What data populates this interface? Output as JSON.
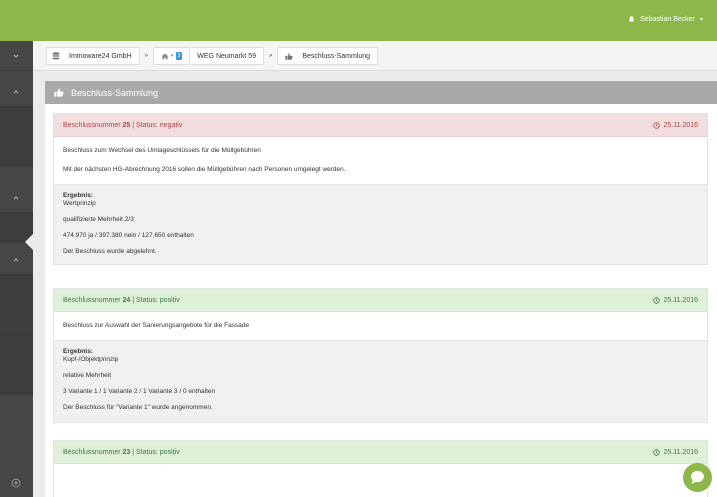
{
  "user": {
    "name": "Sebastian Becker",
    "caret": "▾"
  },
  "breadcrumb": {
    "company": "Immoware24 GmbH",
    "sep": "»",
    "home_caret": "▾",
    "badge": "3",
    "property": "WEG Neumarkt 59",
    "page": "Beschluss-Sammlung"
  },
  "panel": {
    "title": "Beschluss-Sammlung"
  },
  "resolutions": [
    {
      "prefix": "Beschlussnummer",
      "number": "25",
      "status_text": "| Status: negativ",
      "date": "25.11.2016",
      "title": "Beschluss zum Wechsel des Umlageschlüssels für die Müllgebühren",
      "description": "Mit der nächsten HG-Abrechnung 2016 sollen die Müllgebühren nach Personen umgelegt werden.",
      "result_label": "Ergebnis:",
      "principle": "Wertprinzip",
      "majority": "qualifizierte Mehrheit 2/3",
      "votes": "474.970 ja / 397.380 nein / 127.650 enthalten",
      "outcome": "Der Beschluss wurde abgelehnt."
    },
    {
      "prefix": "Beschlussnummer",
      "number": "24",
      "status_text": "| Status: positiv",
      "date": "25.11.2016",
      "title": "Beschluss zur Auswahl der Sanierungsangebote für die Fassade",
      "result_label": "Ergebnis:",
      "principle": "Kopf-/Objektprinzip",
      "majority": "relative Mehrheit",
      "votes": "3 Variante 1 / 1 Variante 2 / 1 Variante 3 / 0 enthalten",
      "outcome": "Der Beschluss für \"Variante 1\" wurde angenommen."
    },
    {
      "prefix": "Beschlussnummer",
      "number": "23",
      "status_text": "| Status: positiv",
      "date": "25.11.2016"
    }
  ],
  "colors": {
    "accent": "#8cb84a",
    "sidebar": "#464646",
    "negative": "#a94442",
    "positive": "#3c763d"
  }
}
